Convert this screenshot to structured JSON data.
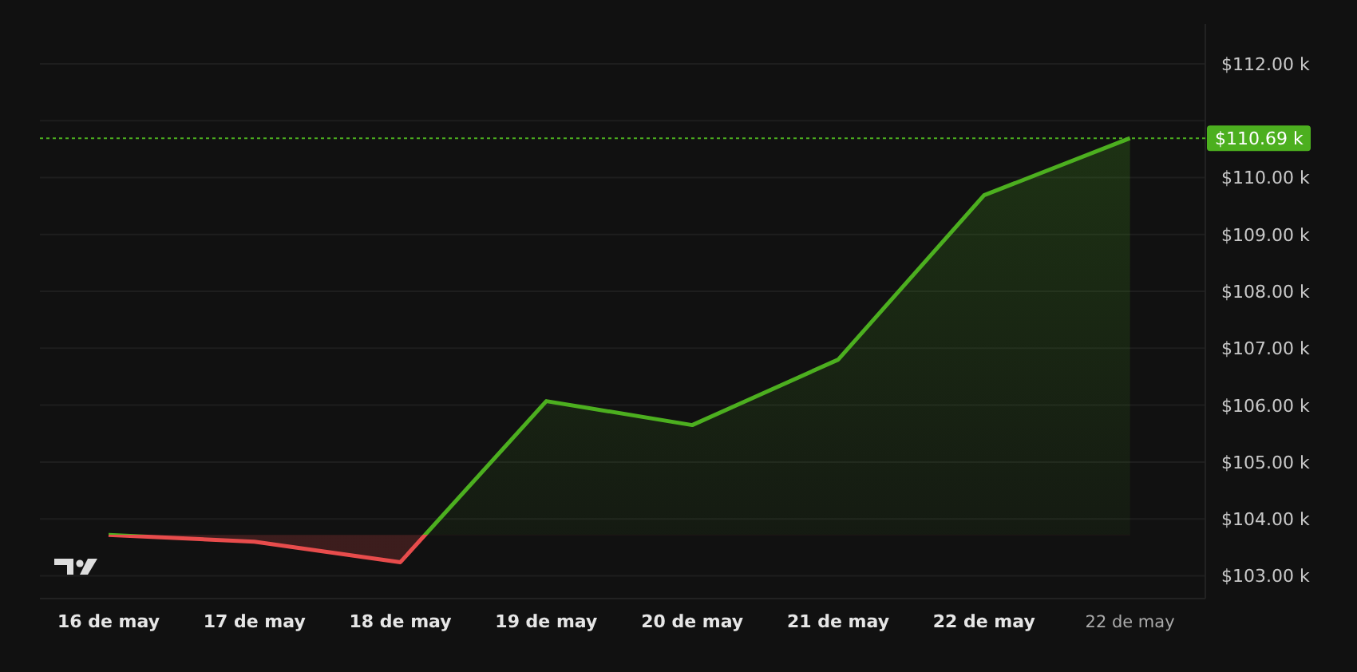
{
  "chart": {
    "chart_data": {
      "type": "area",
      "categories": [
        "16 de may",
        "17 de may",
        "18 de may",
        "19 de may",
        "20 de may",
        "21 de may",
        "22 de may",
        "22 de may"
      ],
      "series": [
        {
          "color": "#4caf1f",
          "values": [
            103.72,
            103.6,
            103.24,
            106.07,
            105.65,
            106.8,
            109.69,
            110.69
          ]
        }
      ],
      "ylim": [
        102.6,
        112.7
      ],
      "yticks": [
        {
          "value": 103,
          "label": "$103.00 k"
        },
        {
          "value": 104,
          "label": "$104.00 k"
        },
        {
          "value": 105,
          "label": "$105.00 k"
        },
        {
          "value": 106,
          "label": "$106.00 k"
        },
        {
          "value": 107,
          "label": "$107.00 k"
        },
        {
          "value": 108,
          "label": "$108.00 k"
        },
        {
          "value": 109,
          "label": "$109.00 k"
        },
        {
          "value": 110,
          "label": "$110.00 k"
        },
        {
          "value": 112,
          "label": "$112.00 k"
        }
      ],
      "grid": true
    },
    "last_price": {
      "label": "$110.69 k"
    }
  }
}
